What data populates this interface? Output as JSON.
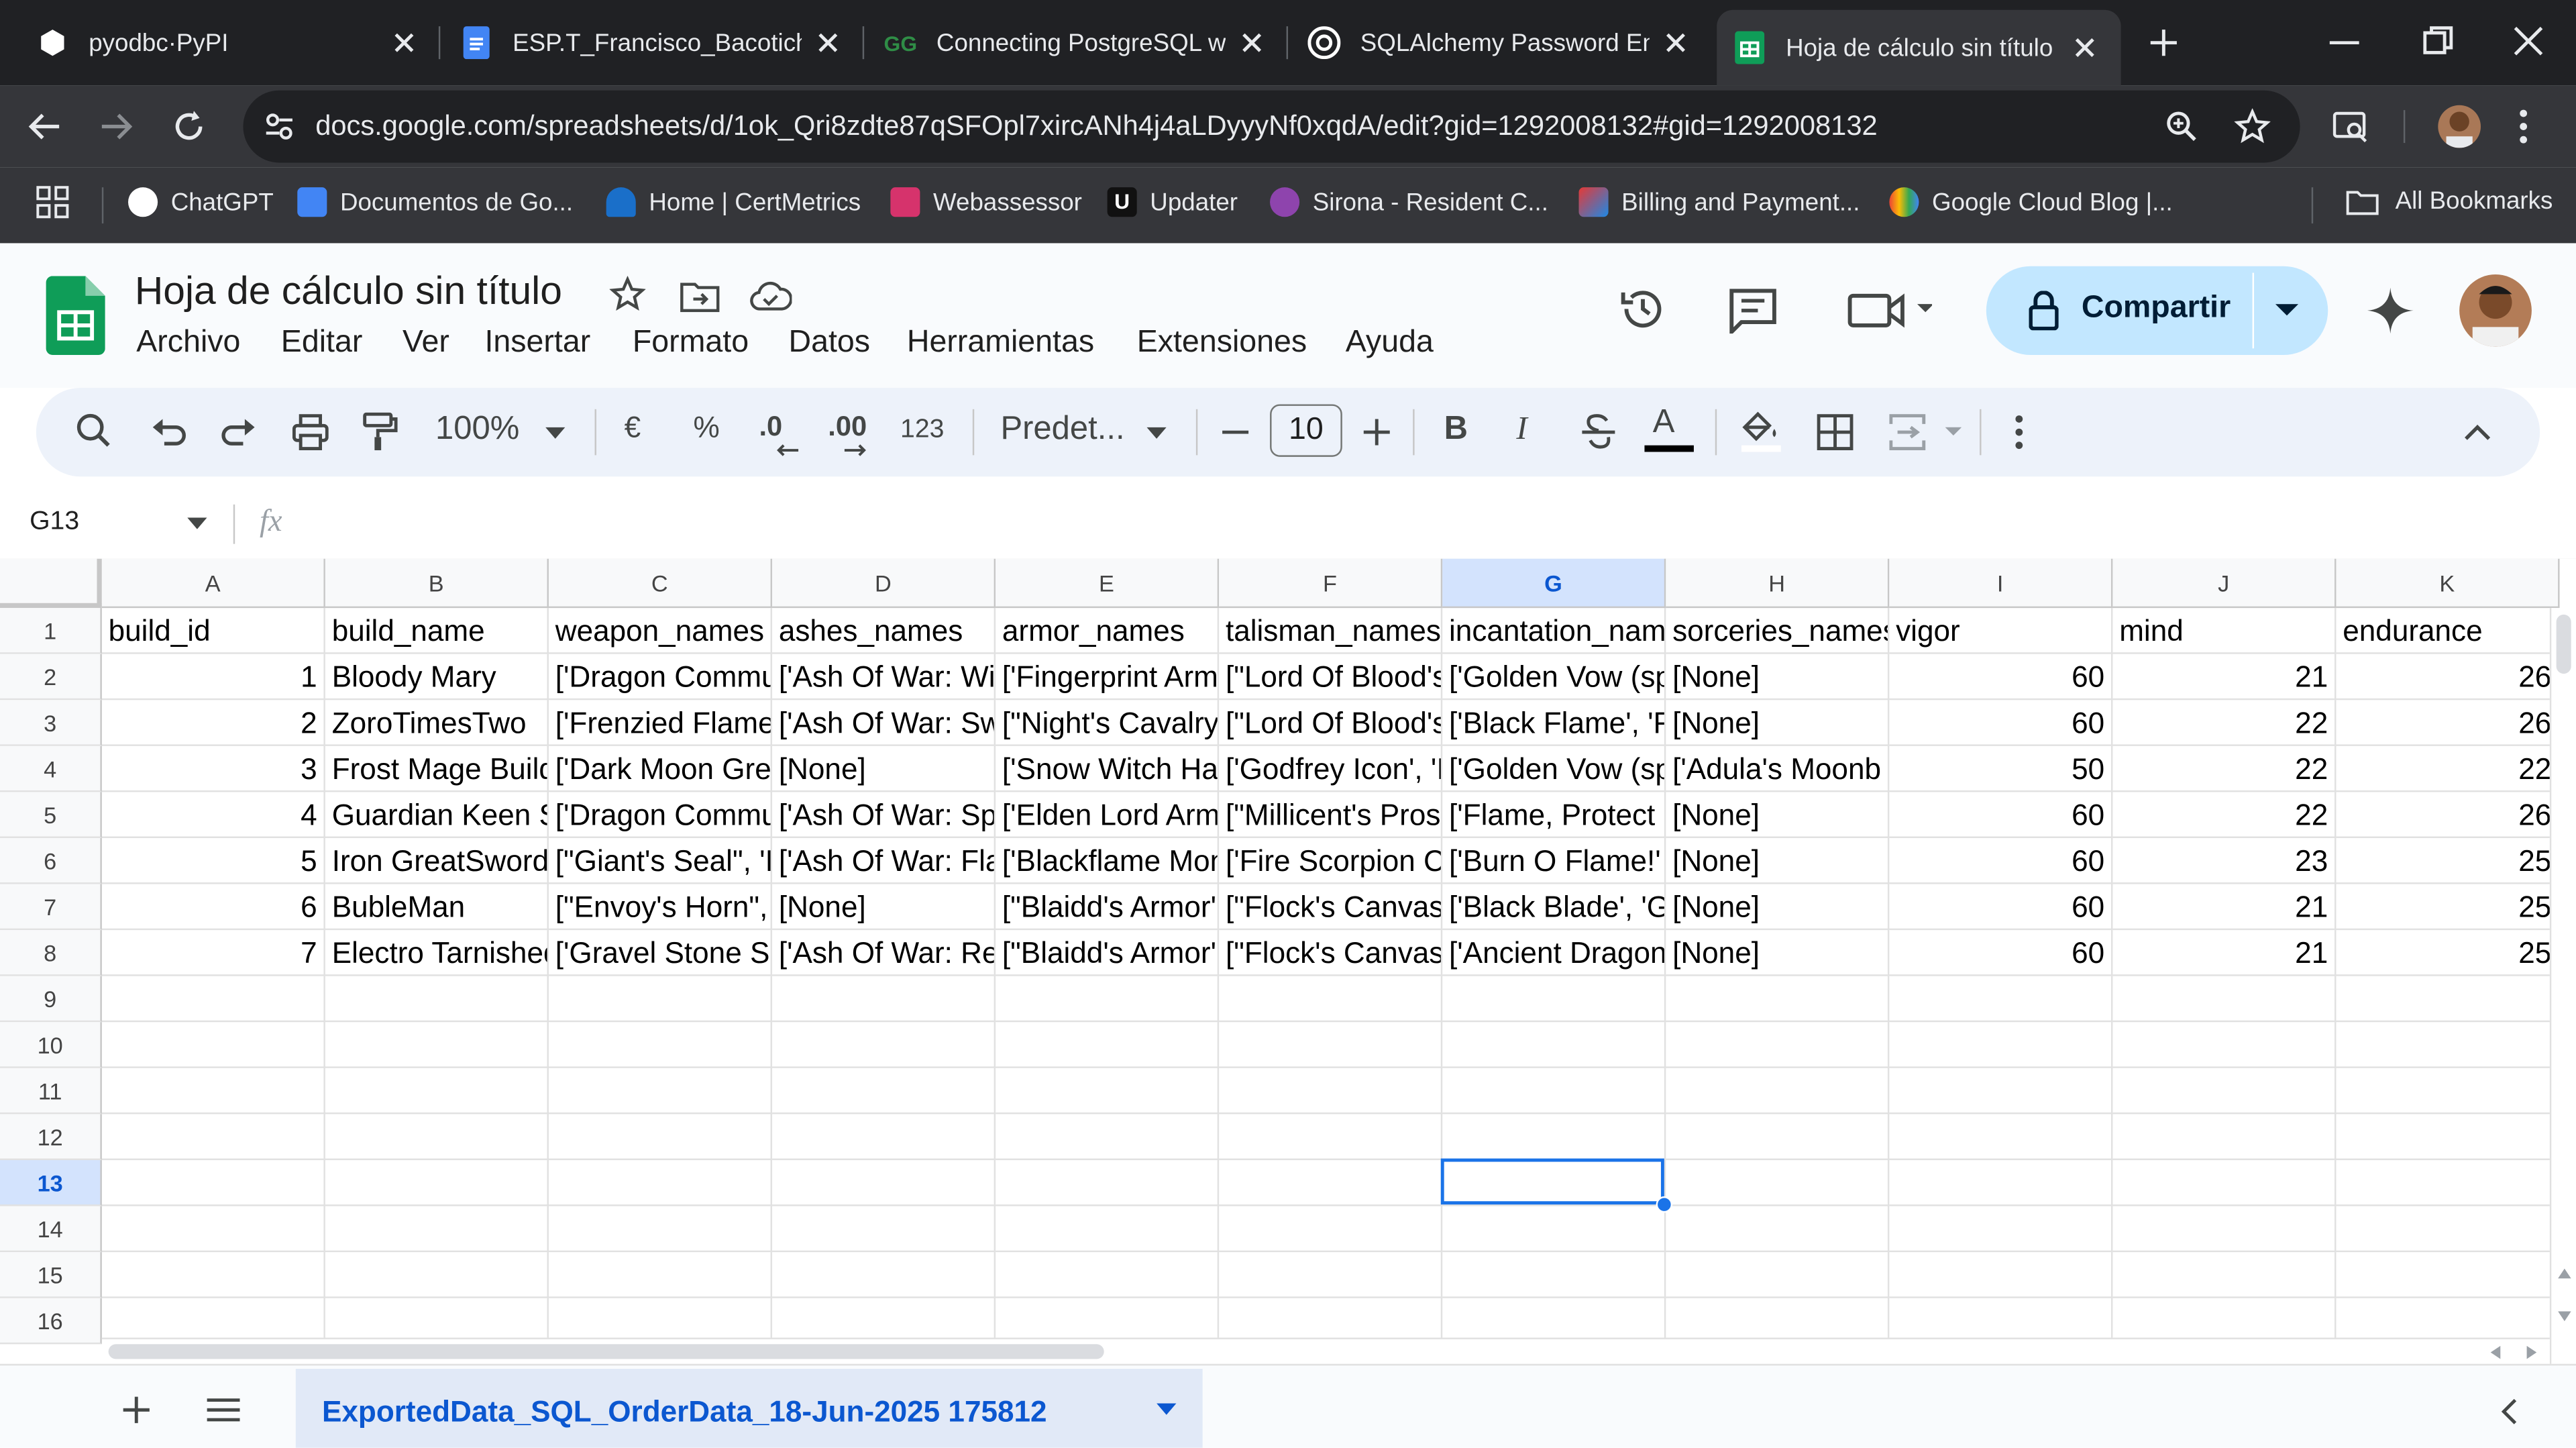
{
  "browser": {
    "tabs": [
      {
        "title": "pyodbc·PyPI"
      },
      {
        "title": "ESP.T_Francisco_Bacotich_"
      },
      {
        "title": "Connecting PostgreSQL w"
      },
      {
        "title": "SQLAlchemy Password Enc"
      },
      {
        "title": "Hoja de cálculo sin título -"
      }
    ],
    "url": "docs.google.com/spreadsheets/d/1ok_Qri8zdte87qSFOpl7xircANh4j4aLDyyyNf0xqdA/edit?gid=1292008132#gid=1292008132",
    "bookmarks": [
      "ChatGPT",
      "Documentos de Go...",
      "Home | CertMetrics",
      "Webassessor",
      "Updater",
      "Sirona - Resident C...",
      "Billing and Payment...",
      "Google Cloud Blog |..."
    ],
    "all_bookmarks": "All Bookmarks"
  },
  "doc": {
    "title": "Hoja de cálculo sin título",
    "menu": [
      "Archivo",
      "Editar",
      "Ver",
      "Insertar",
      "Formato",
      "Datos",
      "Herramientas",
      "Extensiones",
      "Ayuda"
    ],
    "share_label": "Compartir"
  },
  "toolbar": {
    "zoom": "100%",
    "currency": "€",
    "percent": "%",
    "dec_decrease": ".0",
    "dec_increase": ".00",
    "number_format": "123",
    "font": "Predet...",
    "font_size": "10",
    "bold": "B",
    "italic": "I",
    "text_color": "A"
  },
  "formula_bar": {
    "name_box": "G13",
    "fx": "fx"
  },
  "grid": {
    "columns": [
      "A",
      "B",
      "C",
      "D",
      "E",
      "F",
      "G",
      "H",
      "I",
      "J",
      "K"
    ],
    "row_numbers": [
      "1",
      "2",
      "3",
      "4",
      "5",
      "6",
      "7",
      "8",
      "9",
      "10",
      "11",
      "12",
      "13",
      "14",
      "15",
      "16"
    ],
    "selected_cell": "G13",
    "rows": [
      [
        "build_id",
        "build_name",
        "weapon_names",
        "ashes_names",
        "armor_names",
        "talisman_names",
        "incantation_names",
        "sorceries_names",
        "vigor",
        "mind",
        "endurance"
      ],
      [
        "1",
        "Bloody Mary",
        "['Dragon Commu",
        "['Ash Of War: Wi",
        "['Fingerprint Arm",
        "[\"Lord Of Blood's",
        "['Golden Vow (sp",
        "[None]",
        "60",
        "21",
        "26"
      ],
      [
        "2",
        "ZoroTimesTwo",
        "['Frenzied Flame",
        "['Ash Of War: Sw",
        "[\"Night's Cavalry",
        "[\"Lord Of Blood's",
        "['Black Flame', 'F",
        "[None]",
        "60",
        "22",
        "26"
      ],
      [
        "3",
        "Frost Mage Build",
        "['Dark Moon Gre",
        "[None]",
        "['Snow Witch Ha",
        "['Godfrey Icon', 'I",
        "['Golden Vow (sp",
        "['Adula's Moonb",
        "50",
        "22",
        "22"
      ],
      [
        "4",
        "Guardian Keen S",
        "['Dragon Commu",
        "['Ash Of War: Sp",
        "['Elden Lord Arm",
        "[\"Millicent's Pros",
        "['Flame, Protect",
        "[None]",
        "60",
        "22",
        "26"
      ],
      [
        "5",
        "Iron GreatSword",
        "[\"Giant's Seal\", 'I",
        "['Ash Of War: Fla",
        "['Blackflame Mon",
        "['Fire Scorpion C",
        "['Burn O Flame!'",
        "[None]",
        "60",
        "23",
        "25"
      ],
      [
        "6",
        "BubleMan",
        "[\"Envoy's Horn\",",
        "[None]",
        "[\"Blaidd's Armor'",
        "[\"Flock's Canvas",
        "['Black Blade', 'G",
        "[None]",
        "60",
        "21",
        "25"
      ],
      [
        "7",
        "Electro Tarnished",
        "['Gravel Stone S",
        "['Ash Of War: Re",
        "[\"Blaidd's Armor'",
        "[\"Flock's Canvas",
        "['Ancient Dragon",
        "[None]",
        "60",
        "21",
        "25"
      ]
    ]
  },
  "sheet_tab": "ExportedData_SQL_OrderData_18-Jun-2025 175812",
  "colors": {
    "chrome_dark": "#202124",
    "chrome_bar": "#35363a",
    "sheets_green": "#0f9d58",
    "selection": "#1a73e8",
    "share_bg": "#c2e7ff"
  }
}
